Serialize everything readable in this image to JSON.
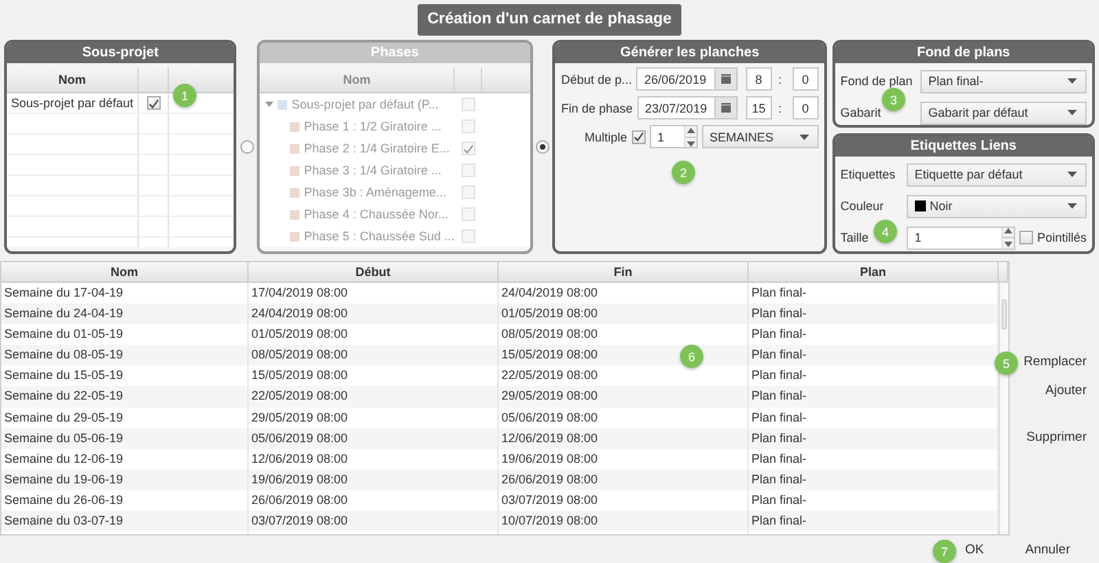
{
  "title": "Création d'un carnet de phasage",
  "sous_projet": {
    "title": "Sous-projet",
    "columns": [
      "Nom"
    ],
    "rows": [
      {
        "name": "Sous-projet par défaut",
        "checked": true
      }
    ]
  },
  "mode_radios": [
    {
      "selected": false
    },
    {
      "selected": true
    }
  ],
  "phases": {
    "title": "Phases",
    "disabled": true,
    "columns": [
      "Nom"
    ],
    "tree": [
      {
        "label": "Sous-projet par défaut (P...",
        "checked": false,
        "expanded": true,
        "children": [
          {
            "label": "Phase 1 : 1/2 Giratoire ...",
            "checked": false
          },
          {
            "label": "Phase 2 : 1/4 Giratoire E...",
            "checked": true
          },
          {
            "label": "Phase 3 : 1/4 Giratoire ...",
            "checked": false
          },
          {
            "label": "Phase 3b : Aménageme...",
            "checked": false
          },
          {
            "label": "Phase 4 : Chaussée Nor...",
            "checked": false
          },
          {
            "label": "Phase 5 : Chaussée Sud ...",
            "checked": false
          }
        ]
      }
    ]
  },
  "generer": {
    "title": "Générer les planches",
    "separator": ":",
    "dates": [
      {
        "label": "Début de p...",
        "date": "26/06/2019",
        "hour": "8",
        "minute": "0"
      },
      {
        "label": "Fin de phase",
        "date": "23/07/2019",
        "hour": "15",
        "minute": "0"
      }
    ],
    "multiple": {
      "label": "Multiple",
      "checked": true,
      "value": "1",
      "unit": "SEMAINES"
    }
  },
  "fond_de_plans": {
    "title": "Fond de plans",
    "fields": [
      {
        "label": "Fond de plan",
        "value": "Plan final-"
      },
      {
        "label": "Gabarit",
        "value": "Gabarit par défaut"
      }
    ]
  },
  "etiquettes_liens": {
    "title": "Etiquettes Liens",
    "etiquettes": {
      "label": "Etiquettes",
      "value": "Etiquette par défaut"
    },
    "couleur": {
      "label": "Couleur",
      "value": "Noir",
      "color": "#000000"
    },
    "taille": {
      "label": "Taille",
      "value": "1"
    },
    "pointilles": {
      "label": "Pointillés",
      "checked": false
    }
  },
  "table": {
    "columns": [
      "Nom",
      "Début",
      "Fin",
      "Plan"
    ],
    "rows": [
      {
        "nom": "Semaine du 17-04-19",
        "debut": "17/04/2019 08:00",
        "fin": "24/04/2019 08:00",
        "plan": "Plan final-"
      },
      {
        "nom": "Semaine du 24-04-19",
        "debut": "24/04/2019 08:00",
        "fin": "01/05/2019 08:00",
        "plan": "Plan final-"
      },
      {
        "nom": "Semaine du 01-05-19",
        "debut": "01/05/2019 08:00",
        "fin": "08/05/2019 08:00",
        "plan": "Plan final-"
      },
      {
        "nom": "Semaine du 08-05-19",
        "debut": "08/05/2019 08:00",
        "fin": "15/05/2019 08:00",
        "plan": "Plan final-"
      },
      {
        "nom": "Semaine du 15-05-19",
        "debut": "15/05/2019 08:00",
        "fin": "22/05/2019 08:00",
        "plan": "Plan final-"
      },
      {
        "nom": "Semaine du 22-05-19",
        "debut": "22/05/2019 08:00",
        "fin": "29/05/2019 08:00",
        "plan": "Plan final-"
      },
      {
        "nom": "Semaine du 29-05-19",
        "debut": "29/05/2019 08:00",
        "fin": "05/06/2019 08:00",
        "plan": "Plan final-"
      },
      {
        "nom": "Semaine du 05-06-19",
        "debut": "05/06/2019 08:00",
        "fin": "12/06/2019 08:00",
        "plan": "Plan final-"
      },
      {
        "nom": "Semaine du 12-06-19",
        "debut": "12/06/2019 08:00",
        "fin": "19/06/2019 08:00",
        "plan": "Plan final-"
      },
      {
        "nom": "Semaine du 19-06-19",
        "debut": "19/06/2019 08:00",
        "fin": "26/06/2019 08:00",
        "plan": "Plan final-"
      },
      {
        "nom": "Semaine du 26-06-19",
        "debut": "26/06/2019 08:00",
        "fin": "03/07/2019 08:00",
        "plan": "Plan final-"
      },
      {
        "nom": "Semaine du 03-07-19",
        "debut": "03/07/2019 08:00",
        "fin": "10/07/2019 08:00",
        "plan": "Plan final-"
      }
    ]
  },
  "side_actions": [
    "Remplacer",
    "Ajouter",
    "Supprimer"
  ],
  "footer_actions": [
    "OK",
    "Annuler"
  ],
  "callouts": [
    "1",
    "2",
    "3",
    "4",
    "5",
    "6",
    "7"
  ]
}
